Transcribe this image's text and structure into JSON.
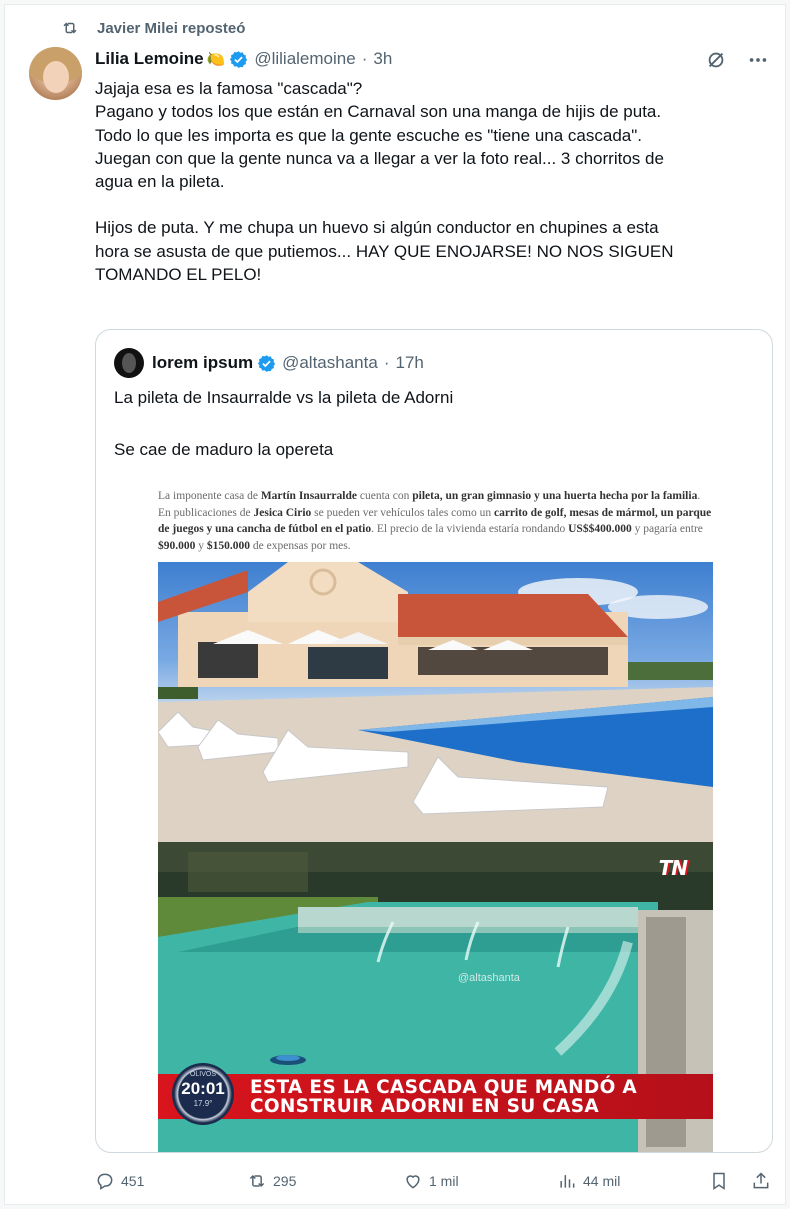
{
  "repost": {
    "label": "Javier Milei reposteó"
  },
  "author": {
    "name": "Lilia Lemoine",
    "emoji": "🍋",
    "handle": "@lilialemoine",
    "time": "3h"
  },
  "tweet": {
    "lines": [
      "Jajaja esa es la famosa \"cascada\"?",
      "Pagano y todos los que están en Carnaval son una manga de hijis de puta.",
      "Todo lo que les importa es que la gente escuche es \"tiene una cascada\".",
      "Juegan con que la gente nunca va a llegar a ver la foto real... 3 chorritos de",
      "agua en la pileta."
    ],
    "lines2": [
      "Hijos de puta. Y me chupa un huevo si algún conductor en chupines a esta",
      "hora se asusta de que putiemos... HAY QUE ENOJARSE! NO NOS SIGUEN",
      "TOMANDO EL PELO!"
    ]
  },
  "quote": {
    "name": "lorem ipsum",
    "handle": "@altashanta",
    "time": "17h",
    "line1": "La pileta de Insaurralde vs la pileta de Adorni",
    "line2": "Se cae de maduro la opereta"
  },
  "article": {
    "p1": "La imponente casa de ",
    "b1": "Martín Insaurralde",
    "p2": " cuenta con ",
    "b2": "pileta, un gran gimnasio y una huerta hecha por la familia",
    "p3": ". En publicaciones de ",
    "b3": "Jesica Cirio",
    "p4": " se pueden ver vehículos tales como un ",
    "b4": "carrito de golf, mesas de mármol, un parque de juegos y una cancha de fútbol en el patio",
    "p5": ". El precio de la vivienda estaría rondando ",
    "b5": "US$$400.000",
    "p6": " y pagaría entre ",
    "b6": "$90.000",
    "p7": " y ",
    "b7": "$150.000",
    "p8": " de expensas por mes."
  },
  "tv": {
    "banner_line1": "ESTA ES LA CASCADA QUE MANDÓ A",
    "banner_line2": "CONSTRUIR ADORNI EN SU CASA",
    "clock_top": "OLIVOS",
    "clock_time": "20:01",
    "clock_temp": "17.9°",
    "logo": "TN",
    "watermark": "@altashanta"
  },
  "stats": {
    "replies": "451",
    "reposts": "295",
    "likes": "1 mil",
    "views": "44 mil"
  },
  "colors": {
    "verified": "#1d9bf0",
    "muted": "#536471",
    "banner": "#d8141c"
  }
}
